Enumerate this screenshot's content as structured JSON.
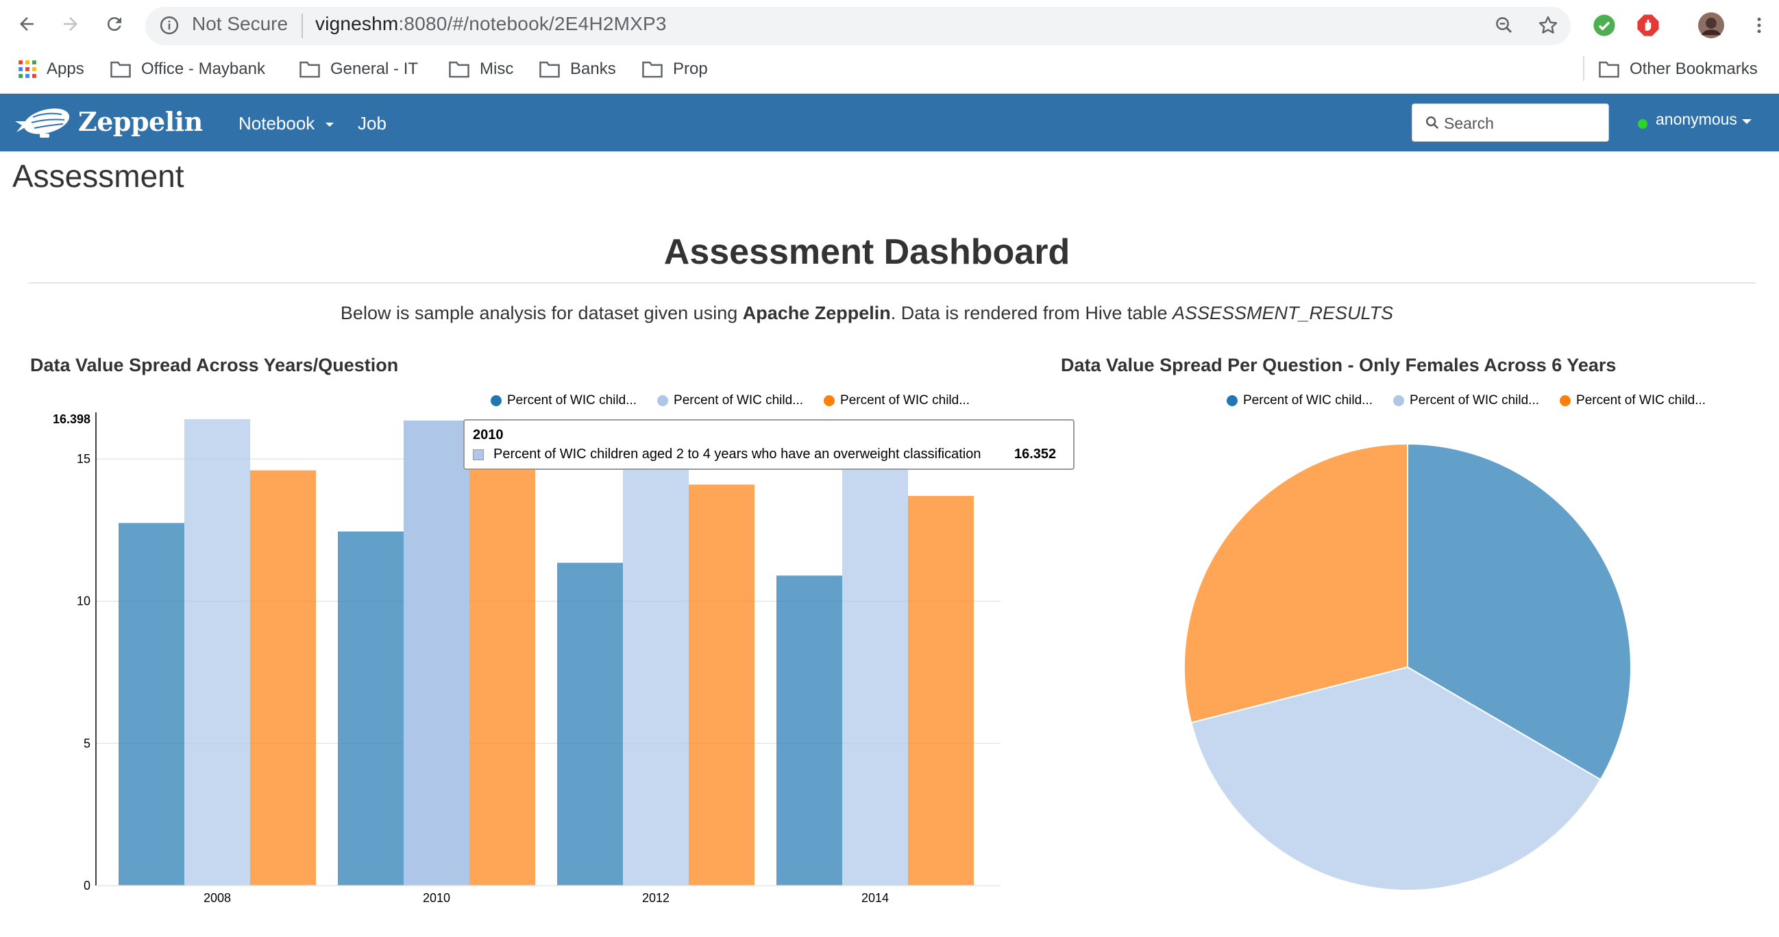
{
  "browser": {
    "url_security": "Not Secure",
    "url_host": "vigneshm",
    "url_rest": ":8080/#/notebook/2E4H2MXP3",
    "bookmarks": [
      "Apps",
      "Office - Maybank",
      "General - IT",
      "Misc",
      "Banks",
      "Prop"
    ],
    "other_bookmarks": "Other Bookmarks"
  },
  "zeppelin": {
    "logo": "Zeppelin",
    "menu_notebook": "Notebook",
    "menu_job": "Job",
    "search_placeholder": "Search",
    "user": "anonymous"
  },
  "notebook": {
    "title": "Assessment",
    "dashboard_title": "Assessment Dashboard",
    "desc_pre": "Below is sample analysis for dataset given using ",
    "desc_bold": "Apache Zeppelin",
    "desc_mid": ". Data is rendered from Hive table ",
    "desc_italic": "ASSESSMENT_RESULTS"
  },
  "colors": {
    "series1": "#1f77b4",
    "series2": "#aec7e8",
    "series3": "#ff7f0e",
    "navbar": "#3071a9"
  },
  "chart_data": [
    {
      "type": "bar",
      "title": "Data Value Spread Across Years/Question",
      "categories": [
        "2008",
        "2010",
        "2012",
        "2014"
      ],
      "ymax_label": "16.398",
      "yticks": [
        0,
        5,
        10,
        15
      ],
      "ylim": [
        0,
        16.398
      ],
      "series": [
        {
          "name": "Percent of WIC child...",
          "values": [
            12.75,
            12.45,
            11.35,
            10.9
          ]
        },
        {
          "name": "Percent of WIC child...",
          "values": [
            16.4,
            16.352,
            15.6,
            15.5
          ]
        },
        {
          "name": "Percent of WIC child...",
          "values": [
            14.6,
            14.7,
            14.1,
            13.7
          ]
        }
      ],
      "tooltip": {
        "title": "2010",
        "label": "Percent of WIC children aged 2 to 4 years who have an overweight classification",
        "value": "16.352"
      }
    },
    {
      "type": "pie",
      "title": "Data Value Spread Per Question - Only Females Across 6 Years",
      "series": [
        {
          "name": "Percent of WIC child...",
          "value": 33.4
        },
        {
          "name": "Percent of WIC child...",
          "value": 37.6
        },
        {
          "name": "Percent of WIC child...",
          "value": 29.0
        }
      ]
    }
  ]
}
